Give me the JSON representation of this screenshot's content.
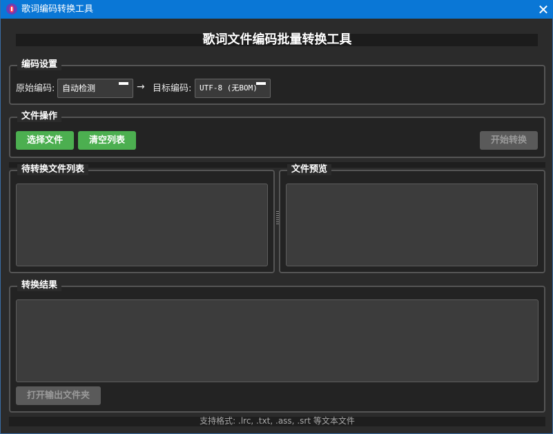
{
  "window": {
    "title": "歌词编码转换工具",
    "close_glyph": "✕"
  },
  "banner": {
    "title": "歌词文件编码批量转换工具"
  },
  "encoding_settings": {
    "group_title": "编码设置",
    "source_label": "原始编码:",
    "source_value": "自动检测",
    "arrow": "→",
    "target_label": "目标编码:",
    "target_value": "UTF-8 (无BOM)"
  },
  "file_ops": {
    "group_title": "文件操作",
    "select_files": "选择文件",
    "clear_list": "清空列表",
    "start_convert": "开始转换"
  },
  "pending_list": {
    "group_title": "待转换文件列表"
  },
  "preview": {
    "group_title": "文件预览"
  },
  "results": {
    "group_title": "转换结果",
    "open_output": "打开输出文件夹"
  },
  "status": {
    "text": "支持格式: .lrc, .txt, .ass, .srt 等文本文件"
  },
  "colors": {
    "titlebar": "#0a77d6",
    "accent_green": "#4caf50",
    "background": "#2b2b2b"
  },
  "icons": {
    "app": "lyrics-app-icon",
    "close": "close-icon",
    "dropdown": "dropdown-arrow-icon"
  }
}
